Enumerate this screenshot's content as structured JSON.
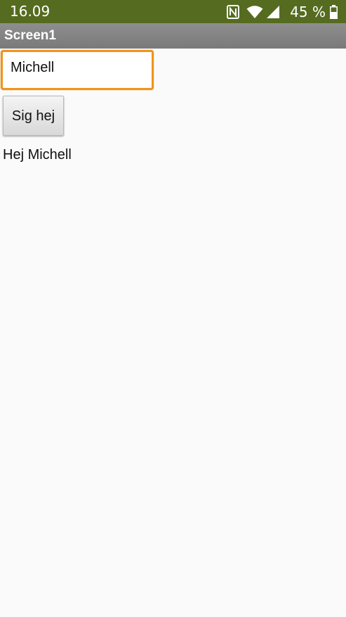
{
  "status_bar": {
    "time": "16.09",
    "battery_percent": "45 %",
    "icons": [
      "nfc-icon",
      "wifi-icon",
      "signal-icon",
      "battery-icon"
    ],
    "background_color": "#556b1f"
  },
  "title_bar": {
    "title": "Screen1"
  },
  "form": {
    "name_value": "Michell",
    "button_label": "Sig hej",
    "greeting": "Hej Michell",
    "input_focus_color": "#f0941d"
  }
}
